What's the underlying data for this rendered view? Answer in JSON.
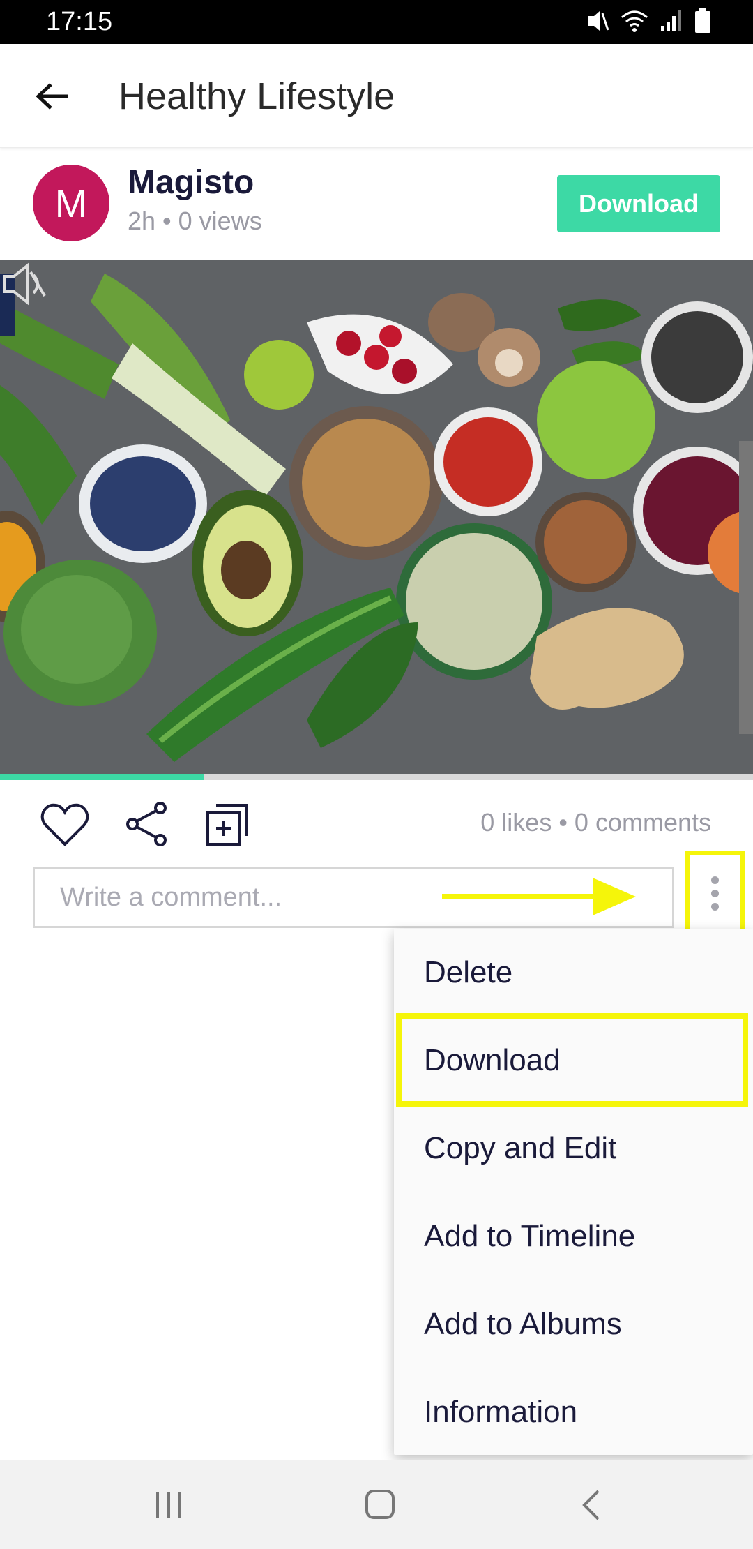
{
  "status_bar": {
    "time": "17:15",
    "icons": [
      "mute-vibrate-icon",
      "wifi-icon",
      "signal-icon",
      "battery-icon"
    ]
  },
  "app_bar": {
    "back_icon": "arrow-back-icon",
    "title": "Healthy Lifestyle"
  },
  "post": {
    "avatar_letter": "M",
    "author": "Magisto",
    "meta": "2h • 0 views",
    "download_label": "Download",
    "progress_fraction": 0.27
  },
  "actions": {
    "icons": [
      "heart-icon",
      "share-icon",
      "add-copy-icon"
    ],
    "counts": "0 likes • 0 comments"
  },
  "comment": {
    "placeholder": "Write a comment...",
    "value": ""
  },
  "menu": {
    "items": [
      {
        "label": "Delete"
      },
      {
        "label": "Download"
      },
      {
        "label": "Copy and Edit"
      },
      {
        "label": "Add to Timeline"
      },
      {
        "label": "Add to Albums"
      },
      {
        "label": "Information"
      }
    ],
    "highlighted_item": "Download"
  },
  "annotations": {
    "color": "#f5f50a"
  },
  "colors": {
    "accent": "#3dd9a5",
    "avatar": "#c2185b",
    "text_dark": "#1a1a3a",
    "text_muted": "#9a9aa4"
  },
  "nav_bar": {
    "icons": [
      "recent-apps-icon",
      "home-icon",
      "nav-back-icon"
    ]
  }
}
